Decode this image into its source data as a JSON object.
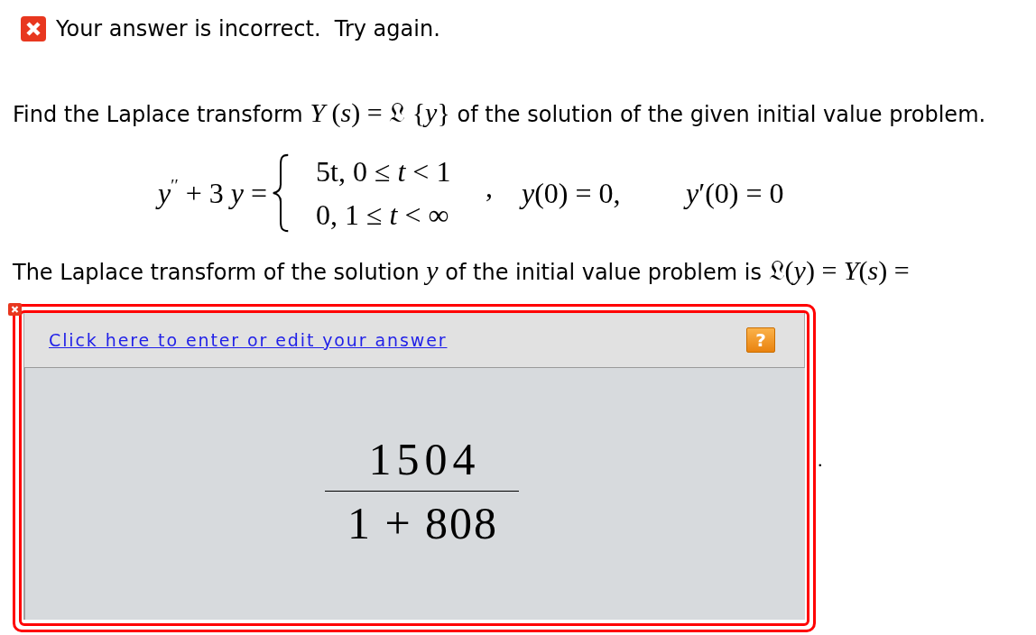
{
  "feedback": {
    "correct": false,
    "message": "Your answer is incorrect.  Try again."
  },
  "question": {
    "segments": [
      {
        "kind": "text",
        "text": "Find the Laplace transform"
      },
      {
        "kind": "math",
        "text": "*Y* (*s*) = 𝔏 {*y*}"
      },
      {
        "kind": "text",
        "text": "of the solution of the given initial value problem."
      }
    ]
  },
  "equation": {
    "lhs": "*y*$^{′′}$ + 3 *y* =",
    "cases": [
      "5t, 0 ≤ *t* < 1",
      "0, 1 ≤ *t* < ∞"
    ],
    "separator": ",",
    "initial_conditions": [
      "*y*(0) = 0,",
      "*y*′(0) = 0"
    ]
  },
  "answer_prompt": {
    "segments": [
      {
        "kind": "text",
        "text": "The Laplace transform of the solution"
      },
      {
        "kind": "math",
        "text": "*y*"
      },
      {
        "kind": "text",
        "text": "of the initial value problem is"
      },
      {
        "kind": "math",
        "text": "𝔏(*y*) = *Y*(*s*) ="
      }
    ]
  },
  "answer_box": {
    "correct": false,
    "edit_link": "Click here to enter or edit your answer",
    "help_button": "?",
    "answer": {
      "numerator": "1504",
      "denominator": "1 + 808"
    },
    "trailing_text": "."
  }
}
